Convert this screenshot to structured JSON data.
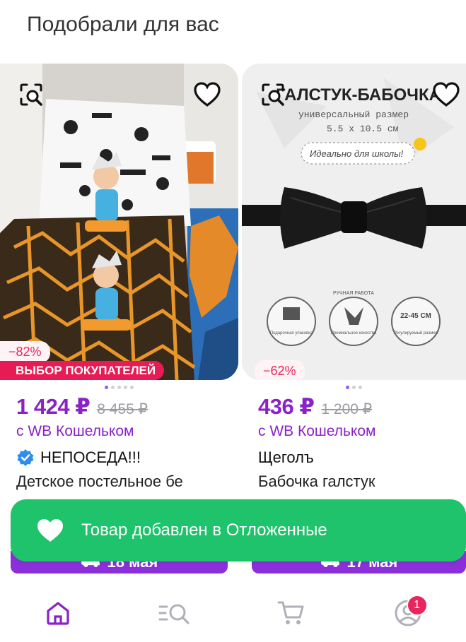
{
  "section": {
    "title": "Подобрали для вас"
  },
  "products": [
    {
      "discount": "−82%",
      "choice_badge": "ВЫБОР ПОКУПАТЕЛЕЙ",
      "dots": 5,
      "active_dot": 0,
      "price": "1 424 ₽",
      "old_price": "8 455 ₽",
      "wallet": "с WB Кошельком",
      "brand": "НЕПОСЕДА!!!",
      "name": "Детское постельное бе",
      "delivery": "18 мая"
    },
    {
      "discount": "−62%",
      "dots": 3,
      "active_dot": 0,
      "price": "436 ₽",
      "old_price": "1 200 ₽",
      "wallet": "с WB Кошельком",
      "brand": "Щеголъ",
      "name": "Бабочка галстук",
      "delivery": "17 мая",
      "photo_text": {
        "title": "ГАЛСТУК-БАБОЧКА",
        "subtitle": "универсальный размер",
        "size": "5.5 x 10.5 см",
        "tag": "Идеально для школы!",
        "features": [
          "Подарочная упаковка",
          "Премиальное качество",
          "Регулируемый размер"
        ],
        "range": "22-45 СМ",
        "handmade": "РУЧНАЯ РАБОТА"
      }
    }
  ],
  "toast": {
    "text": "Товар добавлен в Отложенные"
  },
  "tabbar": {
    "items": [
      "home-icon",
      "catalog-search-icon",
      "cart-icon",
      "profile-icon"
    ],
    "profile_badge": "1",
    "accent": "#8a22c8"
  }
}
